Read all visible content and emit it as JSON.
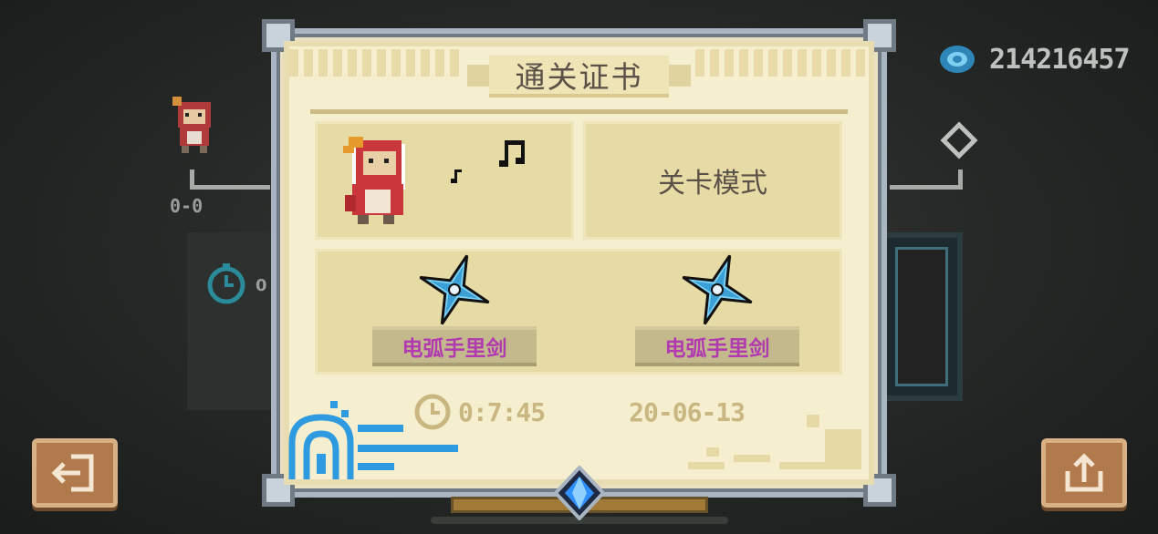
{
  "currency": {
    "icon": "gem-icon",
    "amount": "214216457"
  },
  "background": {
    "level_label": "0-0",
    "timer_count": "0"
  },
  "certificate": {
    "title": "通关证书",
    "mode": "关卡模式",
    "weapons": [
      {
        "label": "电弧手里剑",
        "icon": "shuriken-icon"
      },
      {
        "label": "电弧手里剑",
        "icon": "shuriken-icon"
      }
    ],
    "time": "0:7:45",
    "date": "20-06-13"
  },
  "buttons": {
    "exit": "exit-icon",
    "share": "share-icon"
  },
  "colors": {
    "paper": "#f5efcf",
    "panel": "#e6dba5",
    "weapon_text": "#b23ab0",
    "gold_text": "#c9b680",
    "button": "#b07a4c",
    "accent_blue": "#2e9be0"
  }
}
